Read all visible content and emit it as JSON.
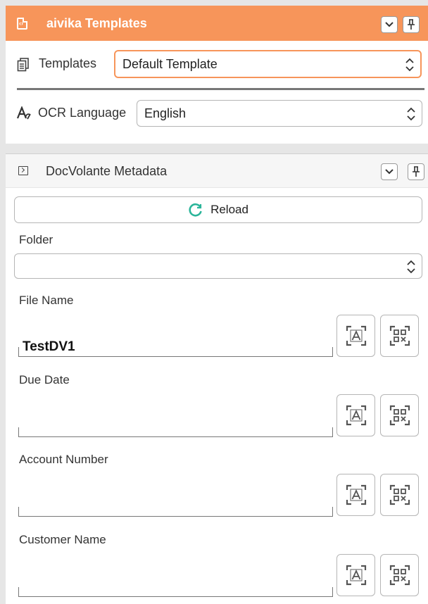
{
  "templates_panel": {
    "title": "aivika Templates",
    "templates_label": "Templates",
    "templates_value": "Default Template",
    "ocr_label": "OCR Language",
    "ocr_value": "English"
  },
  "metadata_panel": {
    "title": "DocVolante Metadata",
    "reload_label": "Reload",
    "folder_label": "Folder",
    "folder_value": "",
    "fields": [
      {
        "label": "File Name",
        "value": "TestDV1"
      },
      {
        "label": "Due Date",
        "value": ""
      },
      {
        "label": "Account Number",
        "value": ""
      },
      {
        "label": "Customer Name",
        "value": ""
      }
    ]
  },
  "colors": {
    "accent": "#f7955a",
    "reload_icon": "#2bb59a"
  },
  "icons": [
    "document-code-icon",
    "chevron-down-icon",
    "pin-icon",
    "templates-icon",
    "text-format-icon",
    "terminal-icon",
    "reload-icon",
    "ocr-text-scan-icon",
    "qr-code-scan-icon",
    "select-arrows-icon"
  ]
}
